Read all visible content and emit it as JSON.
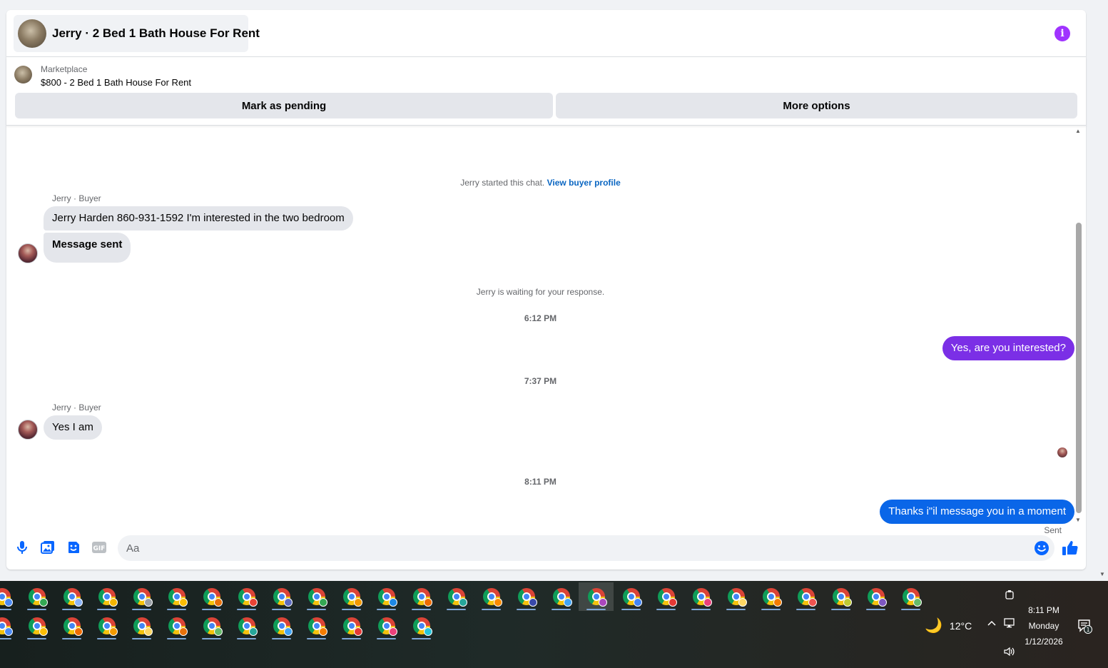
{
  "header": {
    "title": "Jerry · 2 Bed 1 Bath House For Rent",
    "info_glyph": "i"
  },
  "listing": {
    "category": "Marketplace",
    "name": "$800 - 2 Bed 1 Bath House For Rent",
    "mark_pending_label": "Mark as pending",
    "more_options_label": "More options"
  },
  "chat": {
    "started_text": "Jerry started this chat.",
    "view_profile_link": "View buyer profile",
    "sender_label_1": "Jerry · Buyer",
    "msg_1": "Jerry Harden 860-931-1592 I'm interested in the two bedroom",
    "msg_2": "Message sent",
    "waiting_text": "Jerry is waiting for your response.",
    "time_1": "6:12 PM",
    "reply_1": "Yes, are you interested?",
    "time_2": "7:37 PM",
    "sender_label_2": "Jerry · Buyer",
    "msg_3": "Yes I am",
    "time_3": "8:11 PM",
    "reply_2": "Thanks i\"il message you in a moment",
    "status": "Sent"
  },
  "composer": {
    "placeholder": "Aa",
    "gif_label": "GIF"
  },
  "colors": {
    "reply_1_bubble": "#7b2fe6",
    "reply_2_bubble": "#0a66e8",
    "accent": "#0866ff",
    "info": "#a033ff"
  },
  "taskbar": {
    "row1_profile_colors": [
      "#4c8bf5",
      "#34a853",
      "#8ab4f8",
      "#f4b400",
      "#9aa0a6",
      "#fbbc04",
      "#e8710a",
      "#ea4335",
      "#5c6bc0",
      "#34a853",
      "#f29900",
      "#1e88e5",
      "#ef6c00",
      "#26a69a",
      "#fb8c00",
      "#3949ab",
      "#42a5f5",
      "#ab47bc",
      "#4285f4",
      "#e53935",
      "#ec407a",
      "#fdd663",
      "#f57c00",
      "#ef5350",
      "#c0ca33",
      "#7e57c2",
      "#66bb6a"
    ],
    "row2_profile_colors": [
      "#4c8bf5",
      "#fbbc04",
      "#ef6c00",
      "#f29900",
      "#fdd663",
      "#e8710a",
      "#66bb6a",
      "#26a69a",
      "#42a5f5",
      "#f57c00",
      "#e53935",
      "#ec407a",
      "#26c6da"
    ],
    "active_index": 17,
    "weather_temp": "12°C",
    "time": "8:11 PM",
    "day": "Monday",
    "date": "1/12/2026",
    "notification_count": "1"
  }
}
